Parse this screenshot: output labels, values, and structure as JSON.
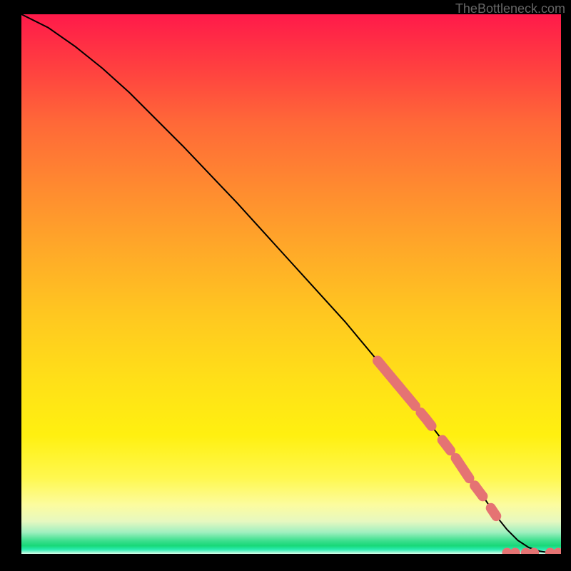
{
  "watermark": "TheBottleneck.com",
  "chart_data": {
    "type": "line",
    "title": "",
    "xlabel": "",
    "ylabel": "",
    "xlim": [
      0,
      100
    ],
    "ylim": [
      0,
      100
    ],
    "curve": {
      "x": [
        0,
        5,
        10,
        15,
        20,
        30,
        40,
        50,
        60,
        70,
        75,
        80,
        83,
        86,
        88,
        90,
        92,
        94,
        96,
        98,
        100
      ],
      "y": [
        100,
        97.5,
        94,
        90,
        85.5,
        75.5,
        65,
        54,
        43,
        31,
        25,
        18.5,
        14,
        10,
        7,
        4.5,
        2.5,
        1.2,
        0.5,
        0.2,
        0.1
      ]
    },
    "highlight_segments": [
      {
        "x_start": 66,
        "x_end": 73
      },
      {
        "x_start": 74,
        "x_end": 76
      },
      {
        "x_start": 78,
        "x_end": 79.5
      },
      {
        "x_start": 80.5,
        "x_end": 83
      },
      {
        "x_start": 84,
        "x_end": 85.5
      },
      {
        "x_start": 87,
        "x_end": 88
      }
    ],
    "highlight_points": [
      {
        "x": 90,
        "y": 0.2
      },
      {
        "x": 91.5,
        "y": 0.2
      },
      {
        "x": 93.5,
        "y": 0.2
      },
      {
        "x": 95,
        "y": 0.2
      },
      {
        "x": 98,
        "y": 0.2
      },
      {
        "x": 99.5,
        "y": 0.2
      }
    ],
    "colors": {
      "curve": "#000000",
      "highlight": "#e57373"
    }
  }
}
